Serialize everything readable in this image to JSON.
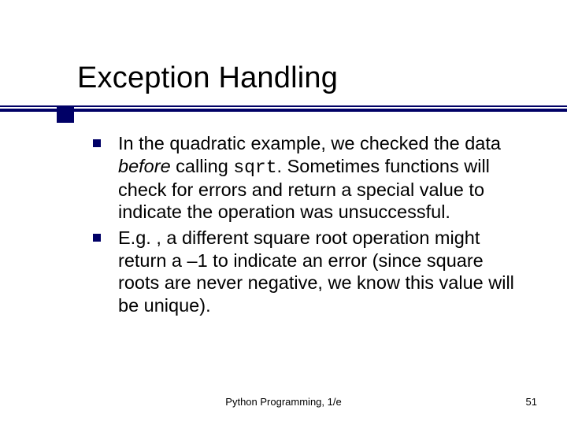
{
  "title": "Exception Handling",
  "bullets": [
    {
      "pre": "In the quadratic example, we checked the data ",
      "em": "before",
      "mid": " calling ",
      "code": "sqrt",
      "post": ". Sometimes functions will check for errors and return a special value to indicate the operation was unsuccessful."
    },
    {
      "pre": "E.g. , a different square root operation might return a –1 to indicate an error (since square roots are never negative, we know this value will be unique).",
      "em": "",
      "mid": "",
      "code": "",
      "post": ""
    }
  ],
  "footer": {
    "center": "Python Programming, 1/e",
    "page": "51"
  }
}
